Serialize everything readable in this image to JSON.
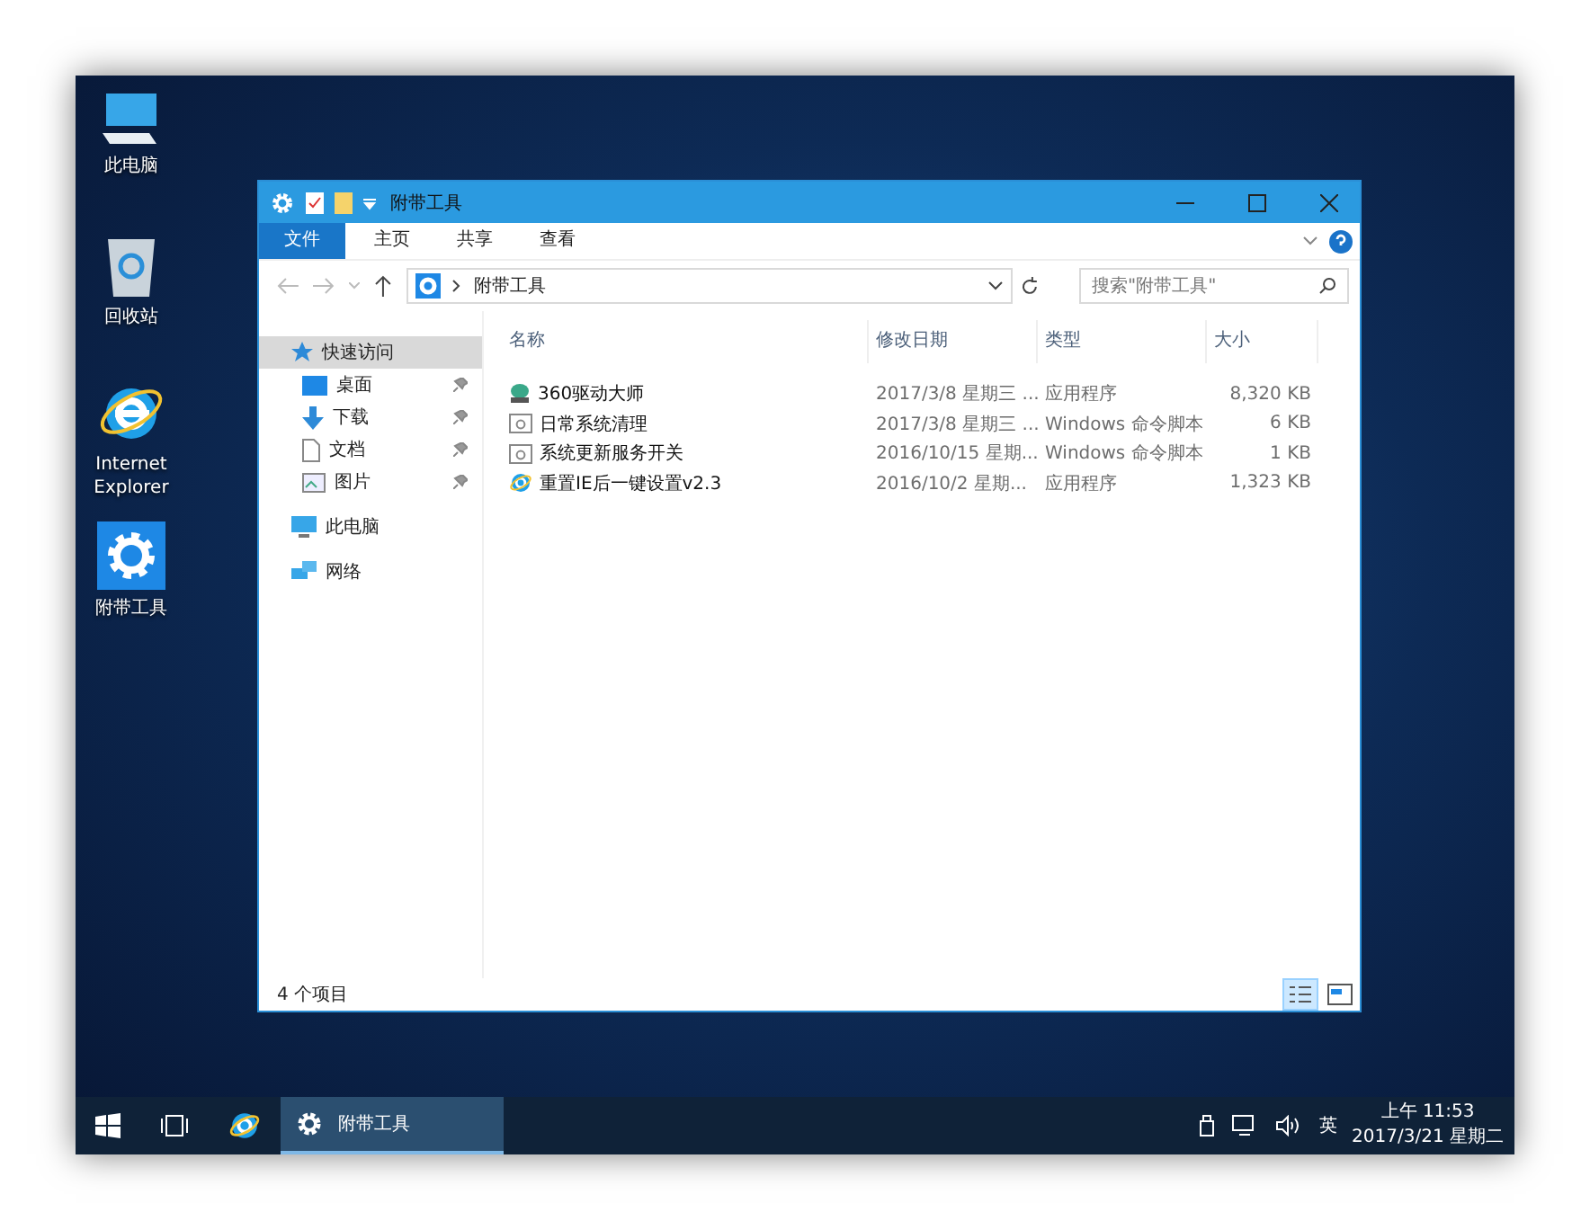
{
  "desktop_icons": [
    {
      "kind": "computer",
      "label": "此电脑"
    },
    {
      "kind": "recycle",
      "label": "回收站"
    },
    {
      "kind": "ie",
      "label": "Internet Explorer"
    },
    {
      "kind": "gear",
      "label": "附带工具"
    }
  ],
  "window": {
    "title": "附带工具",
    "ribbon_tabs": [
      {
        "label": "文件",
        "kind": "file"
      },
      {
        "label": "主页",
        "kind": "tab"
      },
      {
        "label": "共享",
        "kind": "tab"
      },
      {
        "label": "查看",
        "kind": "tab"
      }
    ],
    "address": {
      "path": "附带工具",
      "search_placeholder": "搜索\"附带工具\""
    },
    "sidebar": {
      "items": [
        {
          "label": "快速访问",
          "kind": "star",
          "selected": true,
          "children": [
            {
              "label": "桌面",
              "kind": "desktop",
              "pinned": true,
              "selected": false
            },
            {
              "label": "下载",
              "kind": "download",
              "pinned": true,
              "selected": false
            },
            {
              "label": "文档",
              "kind": "document",
              "pinned": true,
              "selected": false
            },
            {
              "label": "图片",
              "kind": "picture",
              "pinned": true,
              "selected": false
            }
          ]
        },
        {
          "label": "此电脑",
          "kind": "computer",
          "selected": false
        },
        {
          "label": "网络",
          "kind": "network",
          "selected": false
        }
      ]
    },
    "table": {
      "columns": [
        "名称",
        "修改日期",
        "类型",
        "大小"
      ],
      "rows": [
        {
          "kind": "app",
          "name": "360驱动大师",
          "date": "2017/3/8 星期三 ...",
          "type": "应用程序",
          "size": "8,320 KB"
        },
        {
          "kind": "script",
          "name": "日常系统清理",
          "date": "2017/3/8 星期三 ...",
          "type": "Windows 命令脚本",
          "size": "6 KB"
        },
        {
          "kind": "script",
          "name": "系统更新服务开关",
          "date": "2016/10/15 星期...",
          "type": "Windows 命令脚本",
          "size": "1 KB"
        },
        {
          "kind": "ie",
          "name": "重置IE后一键设置v2.3",
          "date": "2016/10/2 星期...",
          "type": "应用程序",
          "size": "1,323 KB"
        }
      ]
    },
    "status_bar": {
      "text": "4 个项目"
    }
  },
  "taskbar": {
    "app": "附带工具",
    "language": "英",
    "time": "上午 11:53",
    "date": "2017/3/21 星期二"
  }
}
